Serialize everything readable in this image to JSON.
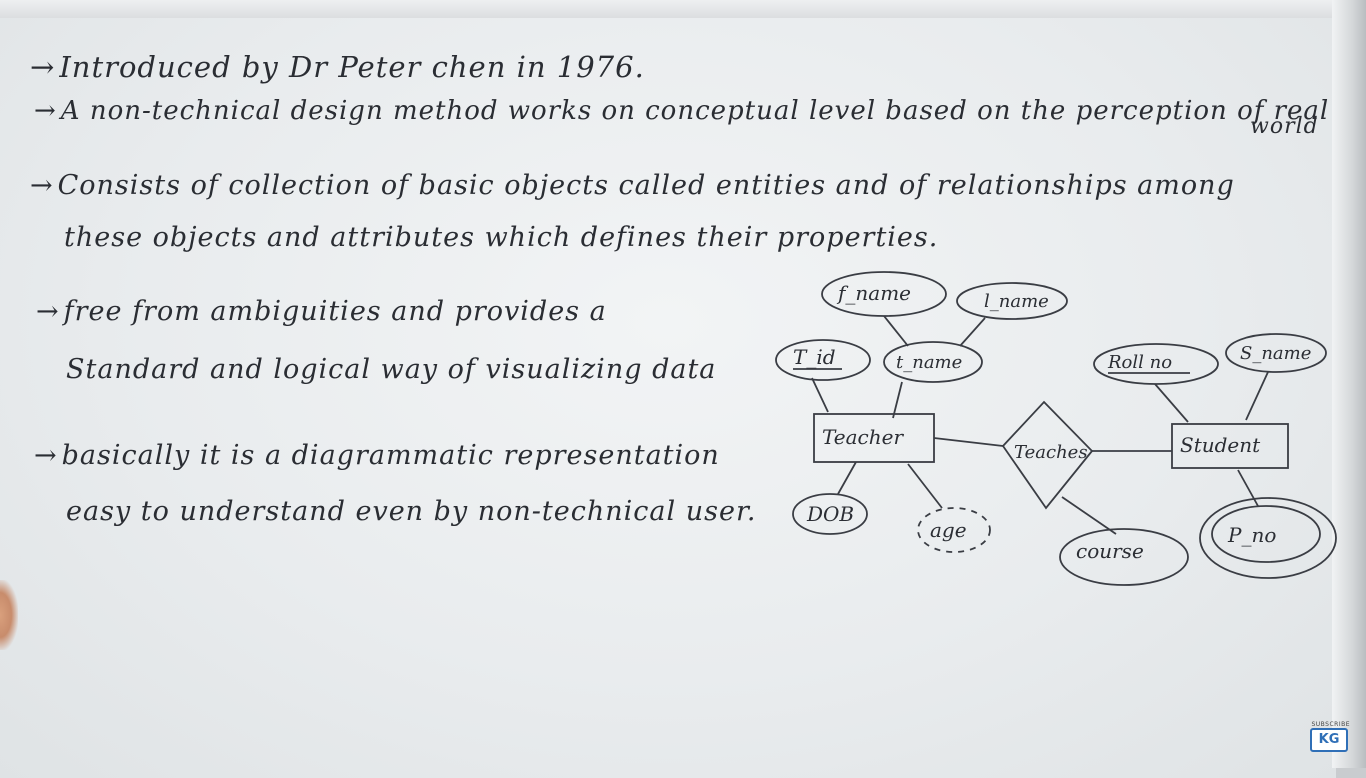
{
  "points": [
    {
      "arrow": "→",
      "text": "Introduced by   Dr Peter chen  in 1976."
    },
    {
      "arrow": "→",
      "text": "A non-technical  design  method  works  on  conceptual  level  based  on  the  perception  of real"
    },
    {
      "arrow": "",
      "text": "world"
    },
    {
      "arrow": "→",
      "text": "Consists of  collection  of  basic objects  called entities  and  of relationships  among"
    },
    {
      "arrow": "",
      "text": "these  objects   and  attributes   which  defines   their   properties."
    },
    {
      "arrow": "→",
      "text": "free  from   ambiguities   and  provides   a"
    },
    {
      "arrow": "",
      "text": "Standard  and  logical  way  of  visualizing  data"
    },
    {
      "arrow": "→",
      "text": "basically  it  is  a  diagrammatic   representation"
    },
    {
      "arrow": "",
      "text": "easy  to  understand   even   by   non-technical  user."
    }
  ],
  "diagram": {
    "entities": {
      "teacher": "Teacher",
      "student": "Student"
    },
    "relationship": "Teaches",
    "attributes": {
      "f_name": "f_name",
      "l_name": "l_name",
      "t_id": "T_id",
      "t_name": "t_name",
      "dob": "DOB",
      "age": "age",
      "roll_no": "Roll no",
      "s_name": "S_name",
      "p_no": "P_no",
      "course": "course"
    }
  },
  "colors": {
    "board": "#e9ecee",
    "marker": "#2a2d33",
    "logo": "#2f6fb7"
  },
  "logo": {
    "text": "KG",
    "caption": "SUBSCRIBE"
  }
}
